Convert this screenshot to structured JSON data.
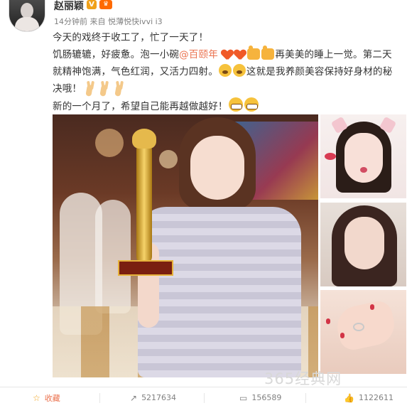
{
  "post": {
    "author": "赵丽颖",
    "verified_badge": "V",
    "member_badge": "♛",
    "timestamp": "14分钟前",
    "source_prefix": "来自",
    "source": "悦薄悦快ivvi i3",
    "lines": {
      "l1": "今天的戏终于收工了，忙了一天了！",
      "l2_a": "饥肠辘辘，好疲惫。泡一小碗",
      "l2_mention": "@百颐年",
      "l2_b": "再美美的睡上一觉。第二天",
      "l3_a": "就精神饱满，气色红润，又活力四射。",
      "l3_b": "这就是我养颜美容保持好身材的秘",
      "l4": "决哦！",
      "l5": "新的一个月了，希望自己能再越做越好！"
    }
  },
  "watermark": "365经典网",
  "actions": {
    "favorite_label": "收藏",
    "repost_count": "5217634",
    "comment_count": "156589",
    "like_count": "1122611"
  },
  "icons": {
    "favorite": "star-icon",
    "repost": "repost-icon",
    "comment": "comment-icon",
    "like": "thumbs-up-icon"
  },
  "colors": {
    "mention": "#eb7350",
    "favorite_icon": "#f0a11a",
    "vip_badge": "#f0a11a"
  }
}
